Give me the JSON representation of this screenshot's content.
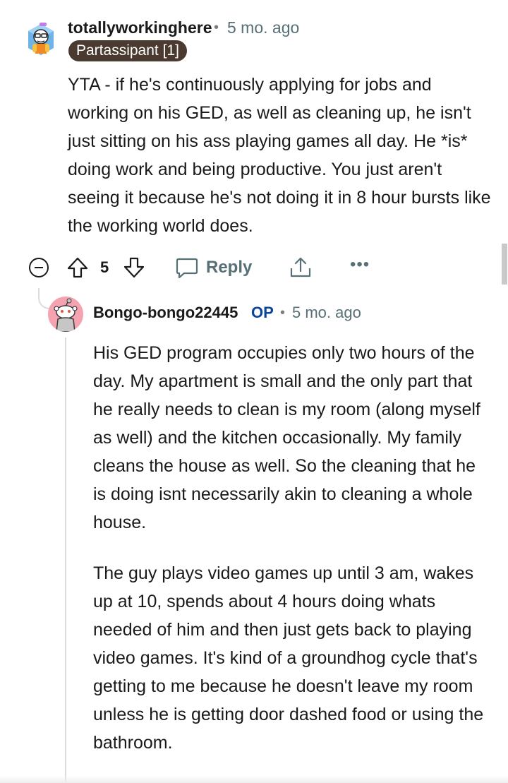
{
  "comment": {
    "author": "totallyworkinghere",
    "separator": "•",
    "time": "5 mo. ago",
    "flair": "Partassipant [1]",
    "body": [
      "YTA - if he's continuously applying for jobs and working on his GED, as well as cleaning up, he isn't just sitting on his ass playing games all day. He *is* doing work and being productive. You just aren't seeing it because he's not doing it in 8 hour bursts like the working world does."
    ],
    "score": "5",
    "reply_label": "Reply",
    "more_label": "•••"
  },
  "reply": {
    "author": "Bongo-bongo22445",
    "op_badge": "OP",
    "separator": "•",
    "time": "5 mo. ago",
    "body": [
      "His GED program occupies only two hours of the day. My apartment is small and the only part that he really needs to clean is my room (along myself as well) and the kitchen occasionally. My family cleans the house as well. So the cleaning that he is doing isnt necessarily akin to cleaning a whole house.",
      "The guy plays video games up until 3 am, wakes up at 10, spends about 4 hours doing whats needed of him and then just gets back to playing video games. It's kind of a groundhog cycle that's getting to me because he doesn't leave my room unless he is getting door dashed food or using the bathroom."
    ]
  },
  "icons": {
    "collapse": "collapse-minus-icon",
    "upvote": "upvote-arrow-icon",
    "downvote": "downvote-arrow-icon",
    "reply": "speech-bubble-icon",
    "share": "share-icon",
    "more": "more-dots-icon"
  },
  "colors": {
    "text": "#1a1a1b",
    "meta": "#576f76",
    "flair_bg": "#4a3a30",
    "op_blue": "#0a449b",
    "thread_line": "#d9dde0",
    "avatar2_bg": "#f5a3b0"
  }
}
